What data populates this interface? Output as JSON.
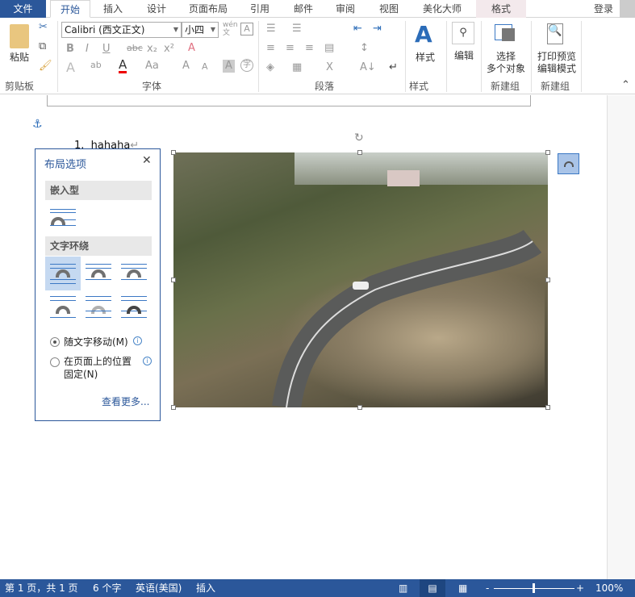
{
  "tabs": {
    "file": "文件",
    "home": "开始",
    "insert": "插入",
    "design": "设计",
    "layout": "页面布局",
    "references": "引用",
    "mailings": "邮件",
    "review": "审阅",
    "view": "视图",
    "beautify": "美化大师",
    "format": "格式",
    "login": "登录"
  },
  "ribbon": {
    "clipboard": {
      "paste": "粘贴",
      "label": "剪贴板"
    },
    "font": {
      "name": "Calibri (西文正文)",
      "size": "小四",
      "label": "字体",
      "wen": "wén\n文"
    },
    "paragraph": {
      "label": "段落"
    },
    "styles": {
      "button": "样式",
      "label": "样式"
    },
    "editing": {
      "button": "编辑"
    },
    "newgroup1": {
      "button_line1": "选择",
      "button_line2": "多个对象",
      "label": "新建组"
    },
    "newgroup2": {
      "button_line1": "打印预览",
      "button_line2": "编辑模式",
      "label": "新建组"
    }
  },
  "document": {
    "list_number": "1.",
    "list_text": "hahaha",
    "para_mark": "↵"
  },
  "layout_popup": {
    "title": "布局选项",
    "close": "✕",
    "inline_section": "嵌入型",
    "wrap_section": "文字环绕",
    "option_move": "随文字移动(M)",
    "option_fixed_line1": "在页面上的位置",
    "option_fixed_line2": "固定(N)",
    "see_more": "查看更多...",
    "selected_move": true
  },
  "status": {
    "page": "第 1 页，共 1 页",
    "words": "6 个字",
    "language": "英语(美国)",
    "mode": "插入",
    "zoom": "100%",
    "zoom_level": 100
  },
  "colors": {
    "accent": "#2b579a",
    "selection": "#c5d9f1"
  }
}
